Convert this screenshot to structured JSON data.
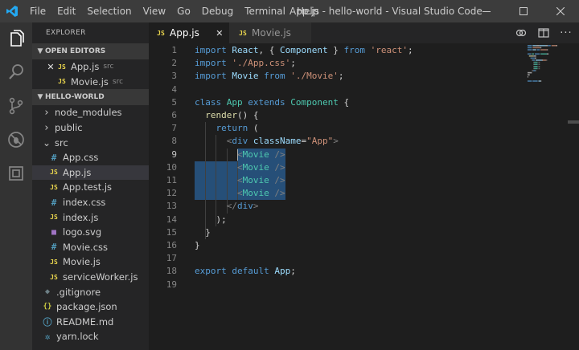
{
  "titlebar": {
    "menus": [
      "File",
      "Edit",
      "Selection",
      "View",
      "Go",
      "Debug",
      "Terminal",
      "Help"
    ],
    "title": "App.js - hello-world - Visual Studio Code"
  },
  "sidebar": {
    "title": "EXPLORER",
    "open_editors": {
      "label": "OPEN EDITORS",
      "items": [
        {
          "name": "App.js",
          "hint": "src",
          "type": "js",
          "active": true
        },
        {
          "name": "Movie.js",
          "hint": "src",
          "type": "js",
          "active": false
        }
      ]
    },
    "project": {
      "label": "HELLO-WORLD",
      "items": [
        {
          "name": "node_modules",
          "kind": "folder",
          "open": false,
          "depth": 0
        },
        {
          "name": "public",
          "kind": "folder",
          "open": false,
          "depth": 0
        },
        {
          "name": "src",
          "kind": "folder",
          "open": true,
          "depth": 0
        },
        {
          "name": "App.css",
          "kind": "css",
          "depth": 1
        },
        {
          "name": "App.js",
          "kind": "js",
          "depth": 1,
          "selected": true
        },
        {
          "name": "App.test.js",
          "kind": "js",
          "depth": 1
        },
        {
          "name": "index.css",
          "kind": "css",
          "depth": 1
        },
        {
          "name": "index.js",
          "kind": "js",
          "depth": 1
        },
        {
          "name": "logo.svg",
          "kind": "svg",
          "depth": 1
        },
        {
          "name": "Movie.css",
          "kind": "css",
          "depth": 1
        },
        {
          "name": "Movie.js",
          "kind": "js",
          "depth": 1
        },
        {
          "name": "serviceWorker.js",
          "kind": "js",
          "depth": 1
        },
        {
          "name": ".gitignore",
          "kind": "git",
          "depth": 0
        },
        {
          "name": "package.json",
          "kind": "json",
          "depth": 0
        },
        {
          "name": "README.md",
          "kind": "md",
          "depth": 0
        },
        {
          "name": "yarn.lock",
          "kind": "yarn",
          "depth": 0
        }
      ]
    }
  },
  "tabs": [
    {
      "label": "App.js",
      "type_label": "JS",
      "active": true
    },
    {
      "label": "Movie.js",
      "type_label": "JS",
      "active": false
    }
  ],
  "editor": {
    "current_line": 9,
    "lines": [
      [
        [
          "kw",
          "import"
        ],
        [
          "pn",
          " "
        ],
        [
          "id",
          "React"
        ],
        [
          "pn",
          ", { "
        ],
        [
          "id",
          "Component"
        ],
        [
          "pn",
          " } "
        ],
        [
          "kw",
          "from"
        ],
        [
          "pn",
          " "
        ],
        [
          "st",
          "'react'"
        ],
        [
          "pn",
          ";"
        ]
      ],
      [
        [
          "kw",
          "import"
        ],
        [
          "pn",
          " "
        ],
        [
          "st",
          "'./App.css'"
        ],
        [
          "pn",
          ";"
        ]
      ],
      [
        [
          "kw",
          "import"
        ],
        [
          "pn",
          " "
        ],
        [
          "id",
          "Movie"
        ],
        [
          "pn",
          " "
        ],
        [
          "kw",
          "from"
        ],
        [
          "pn",
          " "
        ],
        [
          "st",
          "'./Movie'"
        ],
        [
          "pn",
          ";"
        ]
      ],
      [],
      [
        [
          "kw",
          "class"
        ],
        [
          "pn",
          " "
        ],
        [
          "tp",
          "App"
        ],
        [
          "pn",
          " "
        ],
        [
          "kw",
          "extends"
        ],
        [
          "pn",
          " "
        ],
        [
          "tp",
          "Component"
        ],
        [
          "pn",
          " {"
        ]
      ],
      [
        [
          "pn",
          "  "
        ],
        [
          "fn",
          "render"
        ],
        [
          "pn",
          "() {"
        ]
      ],
      [
        [
          "pn",
          "    "
        ],
        [
          "kw",
          "return"
        ],
        [
          "pn",
          " ("
        ]
      ],
      [
        [
          "pn",
          "      "
        ],
        [
          "tgg",
          "<"
        ],
        [
          "tg",
          "div"
        ],
        [
          "pn",
          " "
        ],
        [
          "at",
          "className"
        ],
        [
          "pn",
          "="
        ],
        [
          "st",
          "\"App\""
        ],
        [
          "tgg",
          ">"
        ]
      ],
      [
        [
          "pn",
          "        "
        ],
        [
          "tgg",
          "<"
        ],
        [
          "tp",
          "Movie"
        ],
        [
          "pn",
          " "
        ],
        [
          "tgg",
          "/>"
        ]
      ],
      [
        [
          "pn",
          "        "
        ],
        [
          "tgg",
          "<"
        ],
        [
          "tp",
          "Movie"
        ],
        [
          "pn",
          " "
        ],
        [
          "tgg",
          "/>"
        ]
      ],
      [
        [
          "pn",
          "        "
        ],
        [
          "tgg",
          "<"
        ],
        [
          "tp",
          "Movie"
        ],
        [
          "pn",
          " "
        ],
        [
          "tgg",
          "/>"
        ]
      ],
      [
        [
          "pn",
          "        "
        ],
        [
          "tgg",
          "<"
        ],
        [
          "tp",
          "Movie"
        ],
        [
          "pn",
          " "
        ],
        [
          "tgg",
          "/>"
        ]
      ],
      [
        [
          "pn",
          "      "
        ],
        [
          "tgg",
          "</"
        ],
        [
          "tg",
          "div"
        ],
        [
          "tgg",
          ">"
        ]
      ],
      [
        [
          "pn",
          "    );"
        ]
      ],
      [
        [
          "pn",
          "  }"
        ]
      ],
      [
        [
          "pn",
          "}"
        ]
      ],
      [],
      [
        [
          "kw",
          "export"
        ],
        [
          "pn",
          " "
        ],
        [
          "kw",
          "default"
        ],
        [
          "pn",
          " "
        ],
        [
          "id",
          "App"
        ],
        [
          "pn",
          ";"
        ]
      ],
      []
    ]
  }
}
